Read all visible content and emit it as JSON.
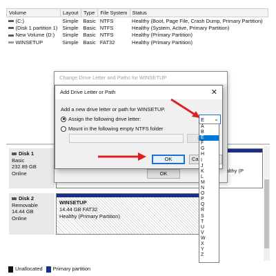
{
  "volume_table": {
    "headers": [
      "Volume",
      "Layout",
      "Type",
      "File System",
      "Status"
    ],
    "rows": [
      [
        "(C:)",
        "Simple",
        "Basic",
        "NTFS",
        "Healthy (Boot, Page File, Crash Dump, Primary Partition)"
      ],
      [
        "(Disk 1 partition 1)",
        "Simple",
        "Basic",
        "NTFS",
        "Healthy (System, Active, Primary Partition)"
      ],
      [
        "New Volume (D:)",
        "Simple",
        "Basic",
        "NTFS",
        "Healthy (Primary Partition)"
      ],
      [
        "WINSETUP",
        "Simple",
        "Basic",
        "FAT32",
        "Healthy (Primary Partition)"
      ]
    ]
  },
  "disks": [
    {
      "name": "Disk 1",
      "type": "Basic",
      "size": "232.89 GB",
      "state": "Online"
    },
    {
      "name": "Disk 2",
      "type": "Removable",
      "size": "14.44 GB",
      "state": "Online"
    }
  ],
  "disk1_partition": {
    "line": "Healthy (P"
  },
  "disk2_partition": {
    "name": "WINSETUP",
    "size": "14.44 GB FAT32",
    "status": "Healthy (Primary Partition)"
  },
  "legend": {
    "unallocated": "Unallocated",
    "primary": "Primary partition",
    "unallocated_color": "#111111",
    "primary_color": "#1c2e86"
  },
  "bg_dialog": {
    "title": "Change Drive Letter and Paths for WINSETUP",
    "ok_label": "OK"
  },
  "dialog": {
    "title": "Add Drive Letter or Path",
    "prompt": "Add a new drive letter or path for WINSETUP.",
    "option_assign": "Assign the following drive letter:",
    "option_mount": "Mount in the following empty NTFS folder",
    "browse_label": "Br",
    "ok_label": "OK",
    "cancel_label": "Ca"
  },
  "drive_letter": {
    "selected": "E",
    "options": [
      "A",
      "B",
      "E",
      "F",
      "G",
      "H",
      "I",
      "J",
      "K",
      "L",
      "M",
      "N",
      "O",
      "P",
      "Q",
      "R",
      "S",
      "T",
      "U",
      "V",
      "W",
      "X",
      "Y",
      "Z"
    ],
    "highlighted": "E"
  },
  "colors": {
    "accent": "#0078d7",
    "arrow": "#e02020",
    "partition_bar": "#1c2e86"
  }
}
